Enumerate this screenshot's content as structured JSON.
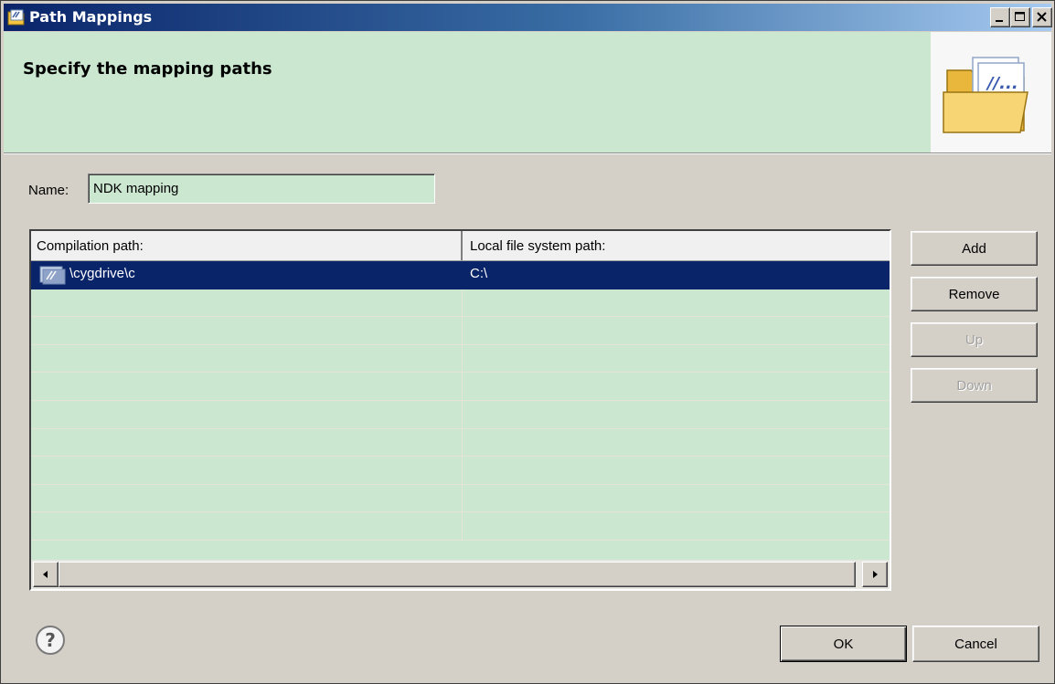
{
  "window": {
    "title": "Path Mappings",
    "heading": "Specify the mapping paths"
  },
  "form": {
    "name_label": "Name:",
    "name_value": "NDK mapping"
  },
  "table": {
    "columns": [
      "Compilation path:",
      "Local file system path:"
    ],
    "rows": [
      {
        "compilation_path": "\\cygdrive\\c",
        "local_path": "C:\\",
        "selected": true
      }
    ]
  },
  "buttons": {
    "add": "Add",
    "remove": "Remove",
    "up": "Up",
    "down": "Down",
    "ok": "OK",
    "cancel": "Cancel"
  },
  "colors": {
    "selection": "#0a246a",
    "banner_bg": "#cbe7d0",
    "dialog_bg": "#d4d0c8"
  }
}
